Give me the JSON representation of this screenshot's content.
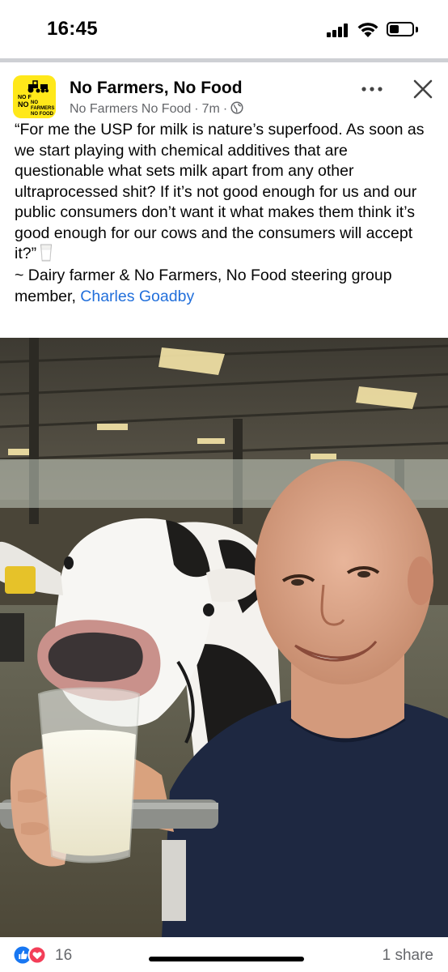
{
  "status_bar": {
    "time": "16:45"
  },
  "post": {
    "page_name": "No Farmers, No Food",
    "page_handle": "No Farmers No Food",
    "time_ago": "7m",
    "audience_icon": "globe-icon",
    "avatar_text_line1": "NO F",
    "avatar_text_line2": "NO",
    "avatar_text_line3": "NO FARMERS",
    "avatar_text_line4": "NO FOOD",
    "quote_text": "“For me the USP for milk is nature’s superfood. As soon as we start playing with chemical additives that are questionable what sets milk apart from any other ultraprocessed shit? If it’s not good enough for us and our public consumers don’t want it what makes them think it’s good enough for our cows and the consumers will accept it?”",
    "attribution_prefix": "~ Dairy farmer & No Farmers, No Food steering group member, ",
    "attribution_link": "Charles Goadby"
  },
  "footer": {
    "reaction_count": "16",
    "share_count": "1 share",
    "reaction_icons": [
      "like-icon",
      "love-icon"
    ]
  },
  "colors": {
    "link": "#216fdb",
    "secondary_text": "#65676b",
    "avatar_bg": "#ffe81a",
    "like_blue": "#1877f2",
    "love_red": "#f33e58"
  }
}
